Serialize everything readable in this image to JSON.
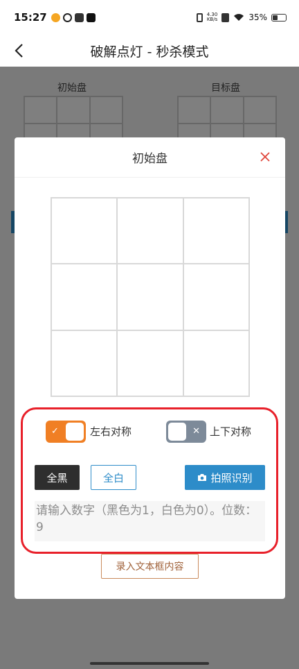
{
  "status_bar": {
    "time": "15:27",
    "net_speed_value": "4.30",
    "net_speed_unit": "KB/s",
    "battery": "35%"
  },
  "nav": {
    "title": "破解点灯 - 秒杀模式"
  },
  "background": {
    "left_board_label": "初始盘",
    "right_board_label": "目标盘"
  },
  "dialog": {
    "title": "初始盘",
    "board": {
      "rows": 3,
      "cols": 3,
      "cells": [
        0,
        0,
        0,
        0,
        0,
        0,
        0,
        0,
        0
      ]
    },
    "toggle_lr": {
      "label": "左右对称",
      "on": true,
      "mark": "✓"
    },
    "toggle_ud": {
      "label": "上下对称",
      "on": false,
      "mark": "✕"
    },
    "buttons": {
      "all_black": "全黑",
      "all_white": "全白",
      "photo_recognize": "拍照识别",
      "enter_text": "录入文本框内容"
    },
    "input": {
      "value": "",
      "placeholder": "请输入数字（黑色为1，白色为0）。位数：9"
    }
  },
  "colors": {
    "accent_blue": "#2d8cc9",
    "toggle_on": "#f07f24",
    "toggle_off": "#7d8a99",
    "highlight_red": "#e8202a"
  }
}
